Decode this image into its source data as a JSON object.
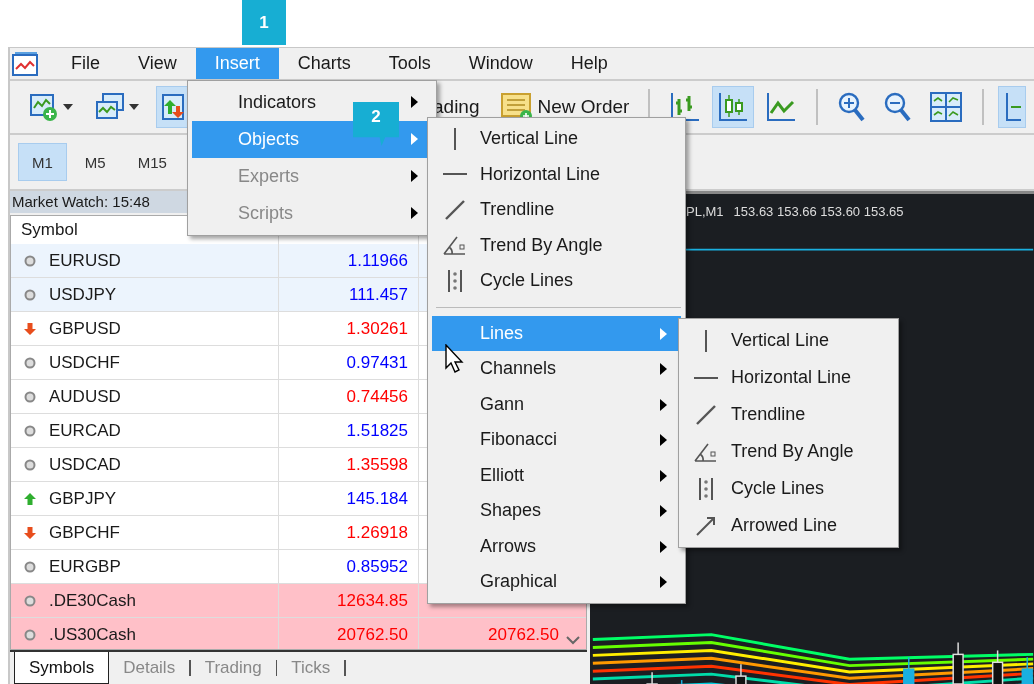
{
  "callouts": [
    {
      "label": "1"
    },
    {
      "label": "2"
    }
  ],
  "menu_bar": [
    {
      "label": "File",
      "selected": false
    },
    {
      "label": "View",
      "selected": false
    },
    {
      "label": "Insert",
      "selected": true
    },
    {
      "label": "Charts",
      "selected": false
    },
    {
      "label": "Tools",
      "selected": false
    },
    {
      "label": "Window",
      "selected": false
    },
    {
      "label": "Help",
      "selected": false
    }
  ],
  "toolbar": [
    {
      "kind": "new-chart",
      "selected": false
    },
    {
      "kind": "profiles",
      "selected": false
    },
    {
      "kind": "auto-trading",
      "selected": true
    },
    {
      "kind": "text",
      "label": "ading",
      "selected": false
    },
    {
      "kind": "new-order",
      "label": "New Order",
      "selected": false
    },
    {
      "kind": "separator"
    },
    {
      "kind": "bar-chart",
      "selected": false
    },
    {
      "kind": "candles",
      "selected": true
    },
    {
      "kind": "line-chart",
      "selected": false
    },
    {
      "kind": "separator"
    },
    {
      "kind": "zoom-in",
      "selected": false
    },
    {
      "kind": "zoom-out",
      "selected": false
    },
    {
      "kind": "tile",
      "selected": false
    },
    {
      "kind": "separator"
    },
    {
      "kind": "crosshair",
      "selected": true
    }
  ],
  "timeframes": [
    {
      "label": "M1",
      "selected": true
    },
    {
      "label": "M5",
      "selected": false
    },
    {
      "label": "M15",
      "selected": false
    }
  ],
  "market_watch": {
    "title": "Market Watch: 15:48",
    "columns": [
      "Symbol"
    ],
    "rows": [
      {
        "kind": "neutral",
        "symbol": "EURUSD",
        "bid": "1.11966",
        "color": "#0000ff",
        "selected": true,
        "alert": false
      },
      {
        "kind": "neutral",
        "symbol": "USDJPY",
        "bid": "111.457",
        "color": "#0000ff",
        "selected": true,
        "alert": false
      },
      {
        "kind": "down",
        "symbol": "GBPUSD",
        "bid": "1.30261",
        "color": "#ff0000",
        "selected": false,
        "alert": false
      },
      {
        "kind": "neutral",
        "symbol": "USDCHF",
        "bid": "0.97431",
        "color": "#0000ff",
        "selected": false,
        "alert": false
      },
      {
        "kind": "neutral",
        "symbol": "AUDUSD",
        "bid": "0.74456",
        "color": "#ff0000",
        "selected": false,
        "alert": false
      },
      {
        "kind": "neutral",
        "symbol": "EURCAD",
        "bid": "1.51825",
        "color": "#0000ff",
        "selected": false,
        "alert": false
      },
      {
        "kind": "neutral",
        "symbol": "USDCAD",
        "bid": "1.35598",
        "color": "#ff0000",
        "selected": false,
        "alert": false
      },
      {
        "kind": "up",
        "symbol": "GBPJPY",
        "bid": "145.184",
        "color": "#0000ff",
        "selected": false,
        "alert": false
      },
      {
        "kind": "down",
        "symbol": "GBPCHF",
        "bid": "1.26918",
        "color": "#ff0000",
        "selected": false,
        "alert": false
      },
      {
        "kind": "neutral",
        "symbol": "EURGBP",
        "bid": "0.85952",
        "color": "#0000ff",
        "selected": false,
        "alert": false
      },
      {
        "kind": "neutral",
        "symbol": ".DE30Cash",
        "bid": "12634.85",
        "color": "#ff0000",
        "selected": false,
        "alert": true
      },
      {
        "kind": "neutral",
        "symbol": ".US30Cash",
        "bid": "20762.50",
        "ask": "20762.50",
        "color": "#ff0000",
        "selected": false,
        "alert": true
      }
    ],
    "tabs": [
      {
        "label": "Symbols",
        "selected": true
      },
      {
        "label": "Details",
        "selected": false
      },
      {
        "label": "Trading",
        "selected": false
      },
      {
        "label": "Ticks",
        "selected": false
      }
    ]
  },
  "chart": {
    "title": "PL,M1",
    "ohlc": "153.63 153.66 153.60 153.65"
  },
  "insert_menu": [
    {
      "label": "Indicators",
      "selected": false,
      "disabled": false
    },
    {
      "label": "Objects",
      "selected": true,
      "disabled": false
    },
    {
      "label": "Experts",
      "selected": false,
      "disabled": true
    },
    {
      "label": "Scripts",
      "selected": false,
      "disabled": true
    }
  ],
  "objects_menu": [
    {
      "kind": "vertical",
      "label": "Vertical Line",
      "selected": false
    },
    {
      "kind": "horizontal",
      "label": "Horizontal Line",
      "selected": false
    },
    {
      "kind": "trend",
      "label": "Trendline",
      "selected": false
    },
    {
      "kind": "angle",
      "label": "Trend By Angle",
      "selected": false
    },
    {
      "kind": "cycle",
      "label": "Cycle Lines",
      "selected": false
    },
    {
      "kind": "separator"
    },
    {
      "kind": "submenu",
      "label": "Lines",
      "selected": true
    },
    {
      "kind": "submenu",
      "label": "Channels",
      "selected": false
    },
    {
      "kind": "submenu",
      "label": "Gann",
      "selected": false
    },
    {
      "kind": "submenu",
      "label": "Fibonacci",
      "selected": false
    },
    {
      "kind": "submenu",
      "label": "Elliott",
      "selected": false
    },
    {
      "kind": "submenu",
      "label": "Shapes",
      "selected": false
    },
    {
      "kind": "submenu",
      "label": "Arrows",
      "selected": false
    },
    {
      "kind": "submenu",
      "label": "Graphical",
      "selected": false
    }
  ],
  "lines_menu": [
    {
      "kind": "vertical",
      "label": "Vertical Line"
    },
    {
      "kind": "horizontal",
      "label": "Horizontal Line"
    },
    {
      "kind": "trend",
      "label": "Trendline"
    },
    {
      "kind": "angle",
      "label": "Trend By Angle"
    },
    {
      "kind": "cycle",
      "label": "Cycle Lines"
    },
    {
      "kind": "arrowed",
      "label": "Arrowed Line"
    }
  ]
}
